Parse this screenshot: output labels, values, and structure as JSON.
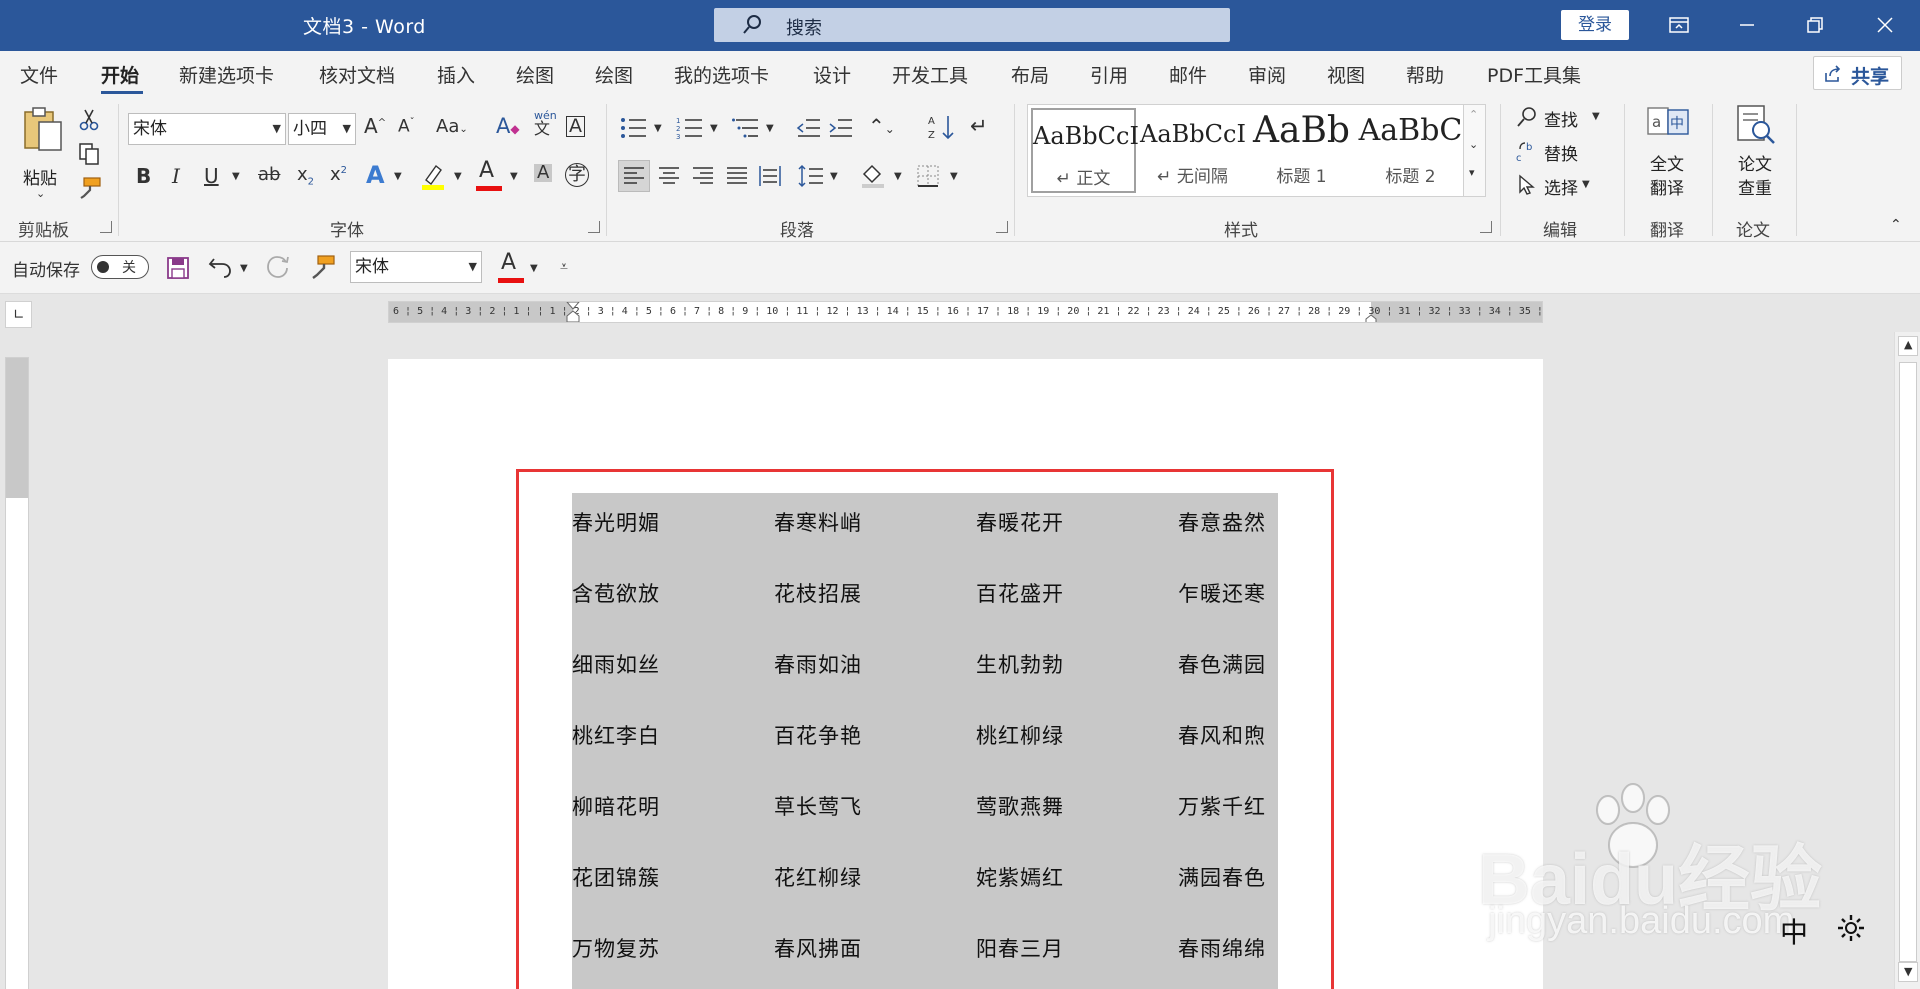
{
  "titlebar": {
    "doc_title": "文档3  -  Word",
    "search_placeholder": "搜索",
    "login_label": "登录"
  },
  "tabs": [
    {
      "label": "文件"
    },
    {
      "label": "开始"
    },
    {
      "label": "新建选项卡"
    },
    {
      "label": "核对文档"
    },
    {
      "label": "插入"
    },
    {
      "label": "绘图"
    },
    {
      "label": "绘图"
    },
    {
      "label": "我的选项卡"
    },
    {
      "label": "设计"
    },
    {
      "label": "开发工具"
    },
    {
      "label": "布局"
    },
    {
      "label": "引用"
    },
    {
      "label": "邮件"
    },
    {
      "label": "审阅"
    },
    {
      "label": "视图"
    },
    {
      "label": "帮助"
    },
    {
      "label": "PDF工具集"
    }
  ],
  "share_label": "共享",
  "ribbon": {
    "clipboard": {
      "paste_label": "粘贴",
      "group_label": "剪贴板"
    },
    "font": {
      "font_name": "宋体",
      "font_size": "小四",
      "group_label": "字体"
    },
    "paragraph": {
      "group_label": "段落"
    },
    "styles": {
      "group_label": "样式",
      "items": [
        {
          "preview": "AaBbCcI",
          "name": "↵ 正文"
        },
        {
          "preview": "AaBbCcI",
          "name": "↵ 无间隔"
        },
        {
          "preview": "AaBb",
          "name": "标题 1"
        },
        {
          "preview": "AaBbC",
          "name": "标题 2"
        }
      ]
    },
    "editing": {
      "find": "查找",
      "replace": "替换",
      "select": "选择",
      "group_label": "编辑"
    },
    "translate": {
      "label_line1": "全文",
      "label_line2": "翻译",
      "group_label": "翻译"
    },
    "paper": {
      "label_line1": "论文",
      "label_line2": "查重",
      "group_label": "论文"
    }
  },
  "qat": {
    "autosave_label": "自动保存",
    "autosave_state": "关",
    "font_name": "宋体"
  },
  "ruler": {
    "horizontal_ticks": "6 ¦ 5 ¦ 4 ¦ 3 ¦ 2 ¦ 1 ¦   ¦ 1 ¦ 2 ¦ 3 ¦ 4 ¦ 5 ¦ 6 ¦ 7 ¦ 8 ¦ 9 ¦ 10 ¦ 11 ¦ 12 ¦ 13 ¦ 14 ¦ 15 ¦ 16 ¦ 17 ¦ 18 ¦ 19 ¦ 20 ¦ 21 ¦ 22 ¦ 23 ¦ 24 ¦ 25 ¦ 26 ¦ 27 ¦ 28 ¦ 29 ¦ 30 ¦ 31 ¦ 32 ¦ 33 ¦ 34 ¦ 35 ¦ 36"
  },
  "document": {
    "rows": [
      [
        "春光明媚",
        "春寒料峭",
        "春暖花开",
        "春意盎然"
      ],
      [
        "含苞欲放",
        "花枝招展",
        "百花盛开",
        "乍暖还寒"
      ],
      [
        "细雨如丝",
        "春雨如油",
        "生机勃勃",
        "春色满园"
      ],
      [
        "桃红李白",
        "百花争艳",
        "桃红柳绿",
        "春风和煦"
      ],
      [
        "柳暗花明",
        "草长莺飞",
        "莺歌燕舞",
        "万紫千红"
      ],
      [
        "花团锦簇",
        "花红柳绿",
        "姹紫嫣红",
        "满园春色"
      ],
      [
        "万物复苏",
        "春风拂面",
        "阳春三月",
        "春雨绵绵"
      ]
    ]
  },
  "watermark": {
    "brand": "Baidu经验",
    "url": "jingyan.baidu.com"
  },
  "ime_label": "中",
  "colors": {
    "titlebar": "#2b579a",
    "highlight_border": "#e83535",
    "table_fill": "#c8c8c8"
  }
}
